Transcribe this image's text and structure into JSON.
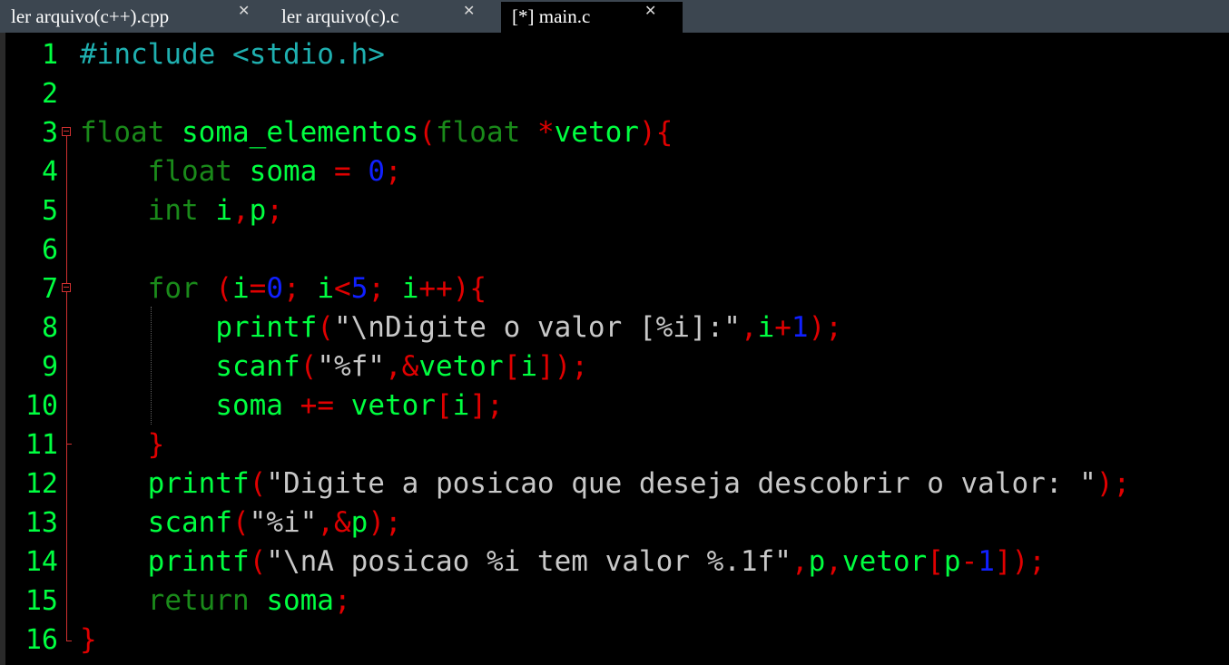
{
  "tabs": [
    {
      "label": "ler arquivo(c++).cpp",
      "active": false
    },
    {
      "label": "ler arquivo(c).c",
      "active": false
    },
    {
      "label": "[*] main.c",
      "active": true
    }
  ],
  "editor": {
    "line_numbers": [
      "1",
      "2",
      "3",
      "4",
      "5",
      "6",
      "7",
      "8",
      "9",
      "10",
      "11",
      "12",
      "13",
      "14",
      "15",
      "16"
    ],
    "lines": [
      "#include <stdio.h>",
      "",
      "float soma_elementos(float *vetor){",
      "    float soma = 0;",
      "    int i,p;",
      "",
      "    for (i=0; i<5; i++){",
      "        printf(\"\\nDigite o valor [%i]:\",i+1);",
      "        scanf(\"%f\",&vetor[i]);",
      "        soma += vetor[i];",
      "    }",
      "    printf(\"Digite a posicao que deseja descobrir o valor: \");",
      "    scanf(\"%i\",&p);",
      "    printf(\"\\nA posicao %i tem valor %.1f\",p,vetor[p-1]);",
      "    return soma;",
      "}"
    ]
  },
  "colors": {
    "keyword": "#1a8a1a",
    "identifier": "#00ff40",
    "punctuation": "#e00000",
    "number": "#1020ff",
    "string": "#c8c8c8",
    "preprocessor": "#1fb0b0",
    "background": "#000000",
    "tabbar": "#3c4650"
  },
  "icons": {
    "tab_close": "close-icon",
    "fold": "fold-minus-icon"
  }
}
